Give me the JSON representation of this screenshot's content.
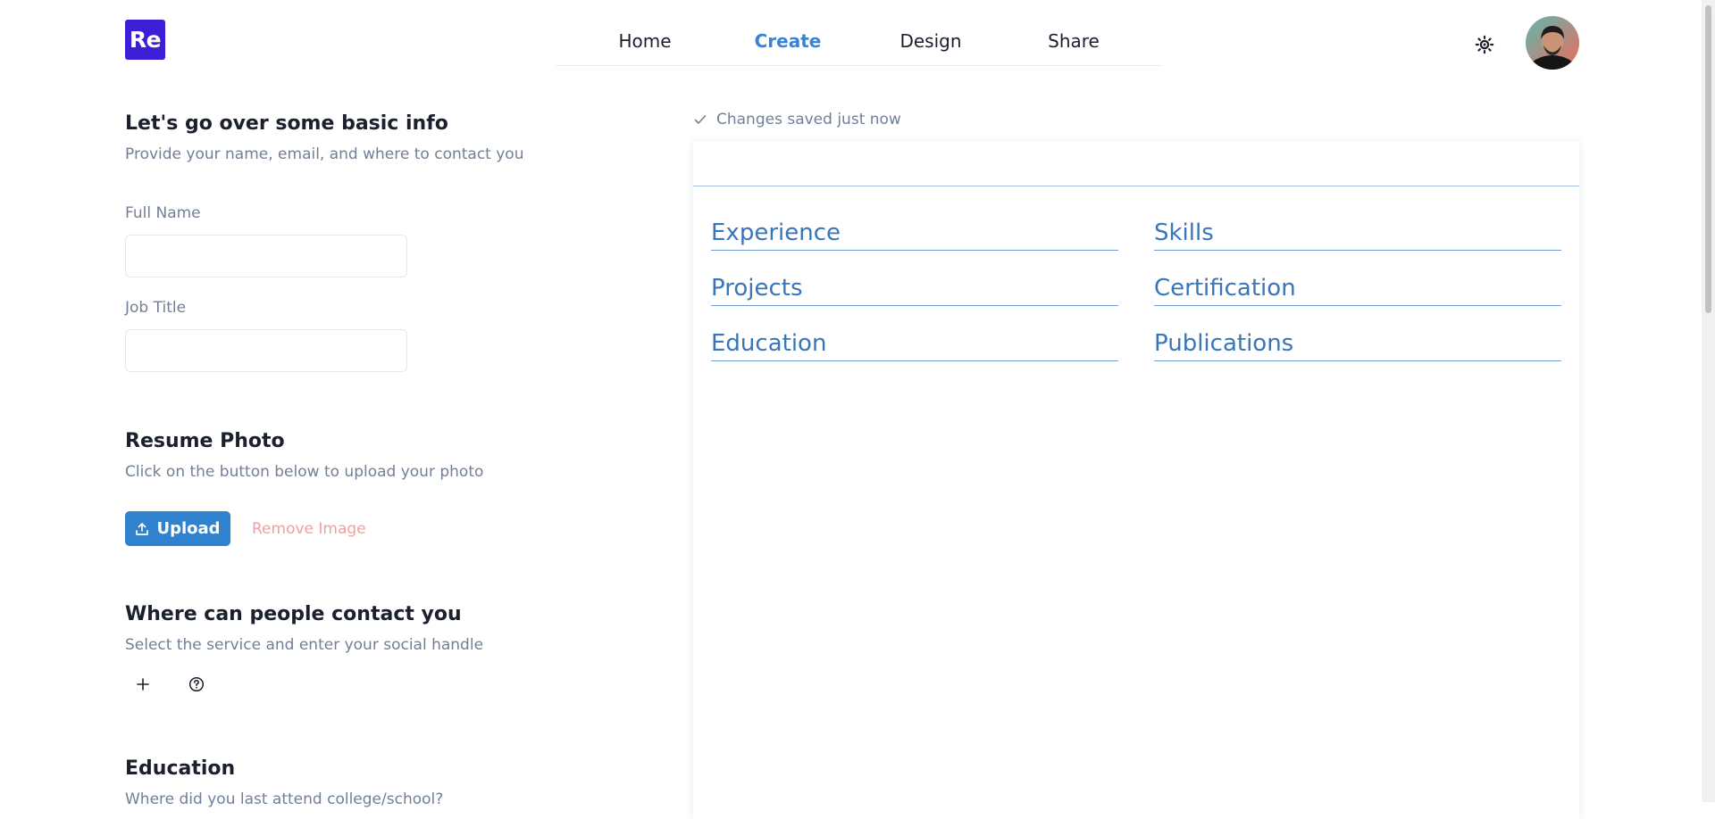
{
  "logo": {
    "text": "Re"
  },
  "nav": {
    "items": [
      {
        "label": "Home",
        "active": false
      },
      {
        "label": "Create",
        "active": true
      },
      {
        "label": "Design",
        "active": false
      },
      {
        "label": "Share",
        "active": false
      }
    ]
  },
  "header_icons": {
    "theme": "sun-icon",
    "avatar": "user-avatar"
  },
  "basic_info": {
    "title": "Let's go over some basic info",
    "subtitle": "Provide your name, email, and where to contact you",
    "full_name_label": "Full Name",
    "full_name_value": "",
    "job_title_label": "Job Title",
    "job_title_value": ""
  },
  "photo": {
    "title": "Resume Photo",
    "subtitle": "Click on the button below to upload your photo",
    "upload_label": "Upload",
    "remove_label": "Remove Image"
  },
  "contact": {
    "title": "Where can people contact you",
    "subtitle": "Select the service and enter your social handle",
    "add_icon": "plus-icon",
    "help_icon": "question-circle-icon"
  },
  "education": {
    "title": "Education",
    "subtitle": "Where did you last attend college/school?"
  },
  "status": {
    "text": "Changes saved just now"
  },
  "preview": {
    "left_sections": [
      "Experience",
      "Projects",
      "Education"
    ],
    "right_sections": [
      "Skills",
      "Certification",
      "Publications"
    ]
  },
  "colors": {
    "brand": "#3b1fd6",
    "accent": "#3182ce",
    "nav_active": "#3b82d4",
    "danger_light": "#f0a0a0",
    "preview_heading": "#3a75b8"
  }
}
